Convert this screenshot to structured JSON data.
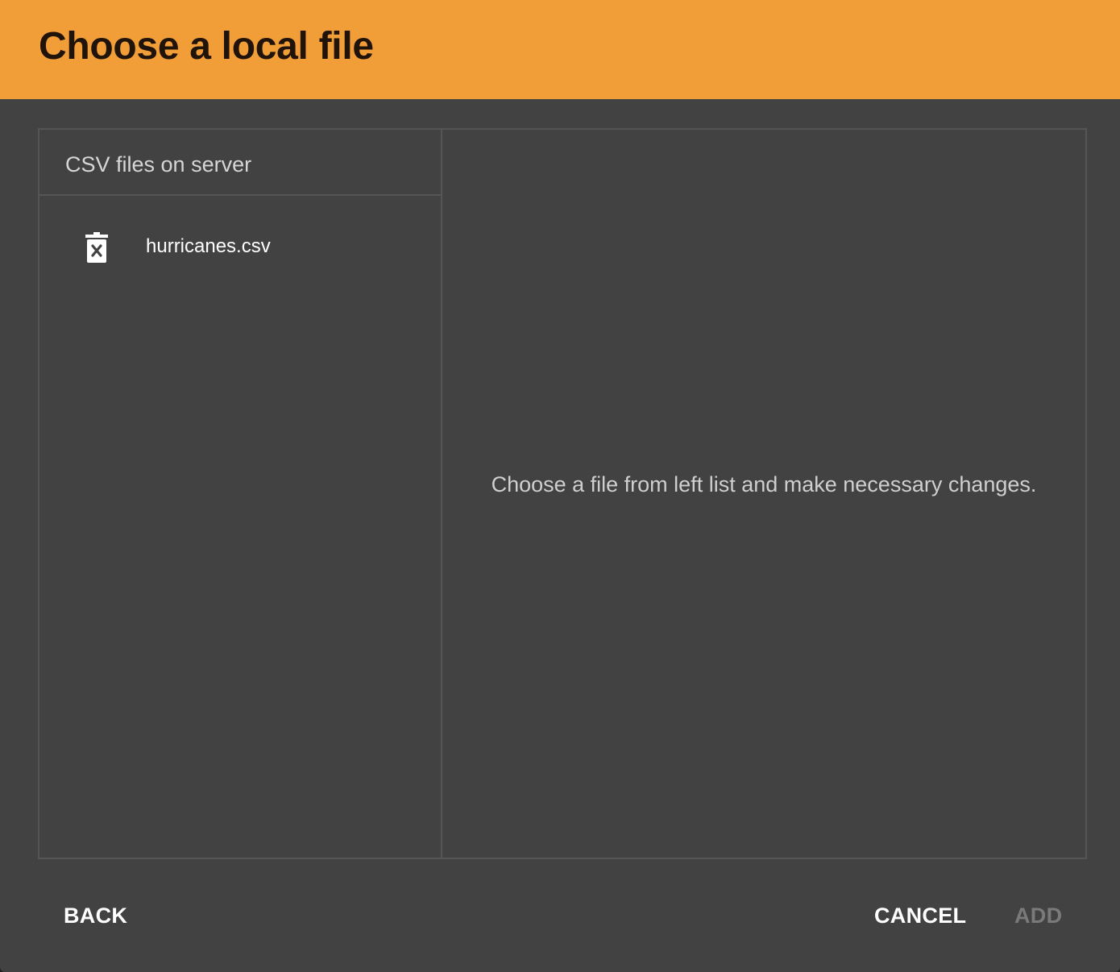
{
  "dialog": {
    "title": "Choose a local file"
  },
  "file_list": {
    "header": "CSV files on server",
    "items": [
      {
        "name": "hurricanes.csv",
        "icon": "delete-forever-icon"
      }
    ]
  },
  "preview": {
    "hint": "Choose a file from left list and make necessary changes."
  },
  "actions": {
    "back_label": "BACK",
    "cancel_label": "CANCEL",
    "add_label": "ADD"
  },
  "colors": {
    "header_bg": "#f19d38",
    "dialog_bg": "#424242",
    "disabled_text": "#7a7a7a"
  }
}
